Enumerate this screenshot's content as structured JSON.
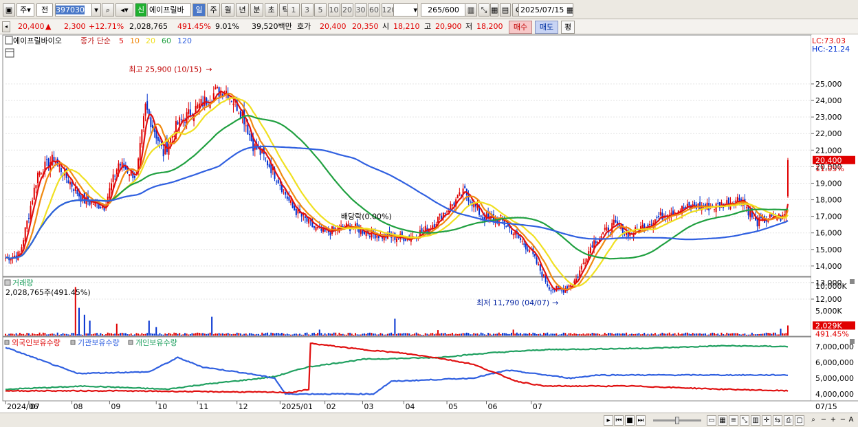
{
  "toolbar": {
    "period_label": "주",
    "market_label": "전",
    "code": "397030",
    "new_badge": "신",
    "stock_name": "에이프릴바",
    "periods": [
      "일",
      "주",
      "월",
      "년",
      "분",
      "초",
      "틱"
    ],
    "intervals": [
      "1",
      "3",
      "5",
      "10",
      "20",
      "30",
      "60",
      "120"
    ],
    "count": "265",
    "count_max": "/600",
    "date": "2025/07/15"
  },
  "quote": {
    "price": "20,400",
    "change_arrow": "▲",
    "change": "2,300",
    "change_pct": "+12.71%",
    "volume": "2,028,765",
    "vol_ratio": "491.45%",
    "turnover_pct": "9.01%",
    "amount": "39,520백만",
    "hoga_label": "호가",
    "ask": "20,400",
    "bid": "20,350",
    "open_label": "시",
    "open": "18,210",
    "high_label": "고",
    "high": "20,900",
    "low_label": "저",
    "low": "18,200",
    "buy_label": "매수",
    "sell_label": "매도",
    "eval_label": "평"
  },
  "price_panel": {
    "name": "에이프릴바이오",
    "legend_title": "종가 단순",
    "ma_labels": [
      "5",
      "10",
      "20",
      "60",
      "120"
    ],
    "ma_colors": [
      "#e01010",
      "#f08a10",
      "#f0e020",
      "#20a040",
      "#3060e0"
    ],
    "lc": "LC:73.03",
    "hc": "HC:-21.24",
    "y_ticks": [
      "25,000",
      "24,000",
      "23,000",
      "22,000",
      "21,000",
      "20,000",
      "19,000",
      "18,000",
      "17,000",
      "16,000",
      "15,000",
      "14,000",
      "13,000",
      "12,000"
    ],
    "current_price_tag": "20,400",
    "current_pct": "11.05%",
    "max_label": "최고 25,900 (10/15)",
    "min_label": "최저 11,790 (04/07)",
    "dividend_label": "배당락(0.00%)"
  },
  "volume_panel": {
    "title": "거래량",
    "value_label": "2,028,765주(491.45%)",
    "y_ticks": [
      "10,000K",
      "5,000K"
    ],
    "current_tag": "2,029K",
    "current_pct": "491.45%"
  },
  "holding_panel": {
    "series_labels": [
      "외국인보유수량",
      "기관보유수량",
      "개인보유수량"
    ],
    "y_ticks": [
      "7,000,000",
      "6,000,000",
      "5,000,000",
      "4,000,000"
    ]
  },
  "x_ticks": [
    "2024/06",
    "07",
    "08",
    "09",
    "10",
    "11",
    "12",
    "2025/01",
    "02",
    "03",
    "04",
    "05",
    "06",
    "07",
    "07/15"
  ],
  "colors": {
    "up": "#e00000",
    "down": "#0030d0",
    "foreign": "#e01010",
    "institution": "#3060e0",
    "individual": "#20a060"
  },
  "chart_data": {
    "type": "candlestick",
    "title": "",
    "price_range": [
      11500,
      25900
    ],
    "anchors": [
      [
        0,
        14500
      ],
      [
        8,
        14700
      ],
      [
        18,
        19600
      ],
      [
        27,
        20500
      ],
      [
        33,
        19500
      ],
      [
        43,
        18000
      ],
      [
        55,
        17600
      ],
      [
        63,
        20200
      ],
      [
        73,
        19400
      ],
      [
        78,
        23600
      ],
      [
        88,
        20800
      ],
      [
        96,
        22600
      ],
      [
        106,
        23500
      ],
      [
        117,
        24500
      ],
      [
        123,
        24600
      ],
      [
        132,
        23200
      ],
      [
        138,
        21300
      ],
      [
        144,
        20600
      ],
      [
        152,
        19200
      ],
      [
        160,
        17500
      ],
      [
        172,
        16300
      ],
      [
        178,
        16000
      ],
      [
        191,
        16400
      ],
      [
        210,
        15800
      ],
      [
        225,
        15700
      ],
      [
        236,
        16300
      ],
      [
        247,
        17500
      ],
      [
        256,
        18500
      ],
      [
        266,
        16900
      ],
      [
        276,
        16800
      ],
      [
        292,
        15000
      ],
      [
        303,
        12700
      ],
      [
        310,
        12500
      ],
      [
        318,
        13200
      ],
      [
        327,
        15400
      ],
      [
        339,
        16500
      ],
      [
        348,
        15900
      ],
      [
        360,
        16700
      ],
      [
        370,
        17300
      ],
      [
        384,
        17600
      ],
      [
        396,
        17600
      ],
      [
        410,
        18100
      ],
      [
        418,
        16600
      ],
      [
        430,
        17000
      ],
      [
        433,
        16900
      ],
      [
        436,
        17500
      ]
    ],
    "volume_spikes": {
      "39": 9800,
      "41": 5600,
      "44": 4200,
      "47": 3000,
      "62": 2400,
      "80": 3000,
      "84": 1700,
      "115": 3800,
      "175": 1200,
      "217": 3400,
      "241": 1100,
      "283": 1200,
      "432": 1400,
      "436": 2029
    },
    "holdings": {
      "foreign": [
        [
          0,
          4200000
        ],
        [
          60,
          4200000
        ],
        [
          160,
          4100000
        ],
        [
          169,
          4300000
        ],
        [
          170,
          7200000
        ],
        [
          200,
          6800000
        ],
        [
          220,
          6600000
        ],
        [
          240,
          6300000
        ],
        [
          260,
          5900000
        ],
        [
          285,
          4800000
        ],
        [
          300,
          4500000
        ],
        [
          350,
          4500000
        ],
        [
          400,
          4300000
        ],
        [
          436,
          4200000
        ]
      ],
      "institution": [
        [
          0,
          6950000
        ],
        [
          40,
          5300000
        ],
        [
          80,
          5400000
        ],
        [
          96,
          6300000
        ],
        [
          110,
          5700000
        ],
        [
          135,
          5300000
        ],
        [
          150,
          5000000
        ],
        [
          156,
          4000000
        ],
        [
          205,
          4000000
        ],
        [
          215,
          4800000
        ],
        [
          260,
          5000000
        ],
        [
          280,
          5500000
        ],
        [
          315,
          5000000
        ],
        [
          330,
          5200000
        ],
        [
          430,
          5200000
        ],
        [
          436,
          5200000
        ]
      ],
      "individual": [
        [
          0,
          4300000
        ],
        [
          45,
          4500000
        ],
        [
          90,
          4300000
        ],
        [
          110,
          4600000
        ],
        [
          135,
          4900000
        ],
        [
          150,
          5100000
        ],
        [
          168,
          5700000
        ],
        [
          200,
          6200000
        ],
        [
          240,
          6300000
        ],
        [
          270,
          6600000
        ],
        [
          300,
          6800000
        ],
        [
          360,
          6900000
        ],
        [
          400,
          7050000
        ],
        [
          436,
          7000000
        ]
      ]
    },
    "current": {
      "price": 20400,
      "volume": 2028765
    }
  }
}
